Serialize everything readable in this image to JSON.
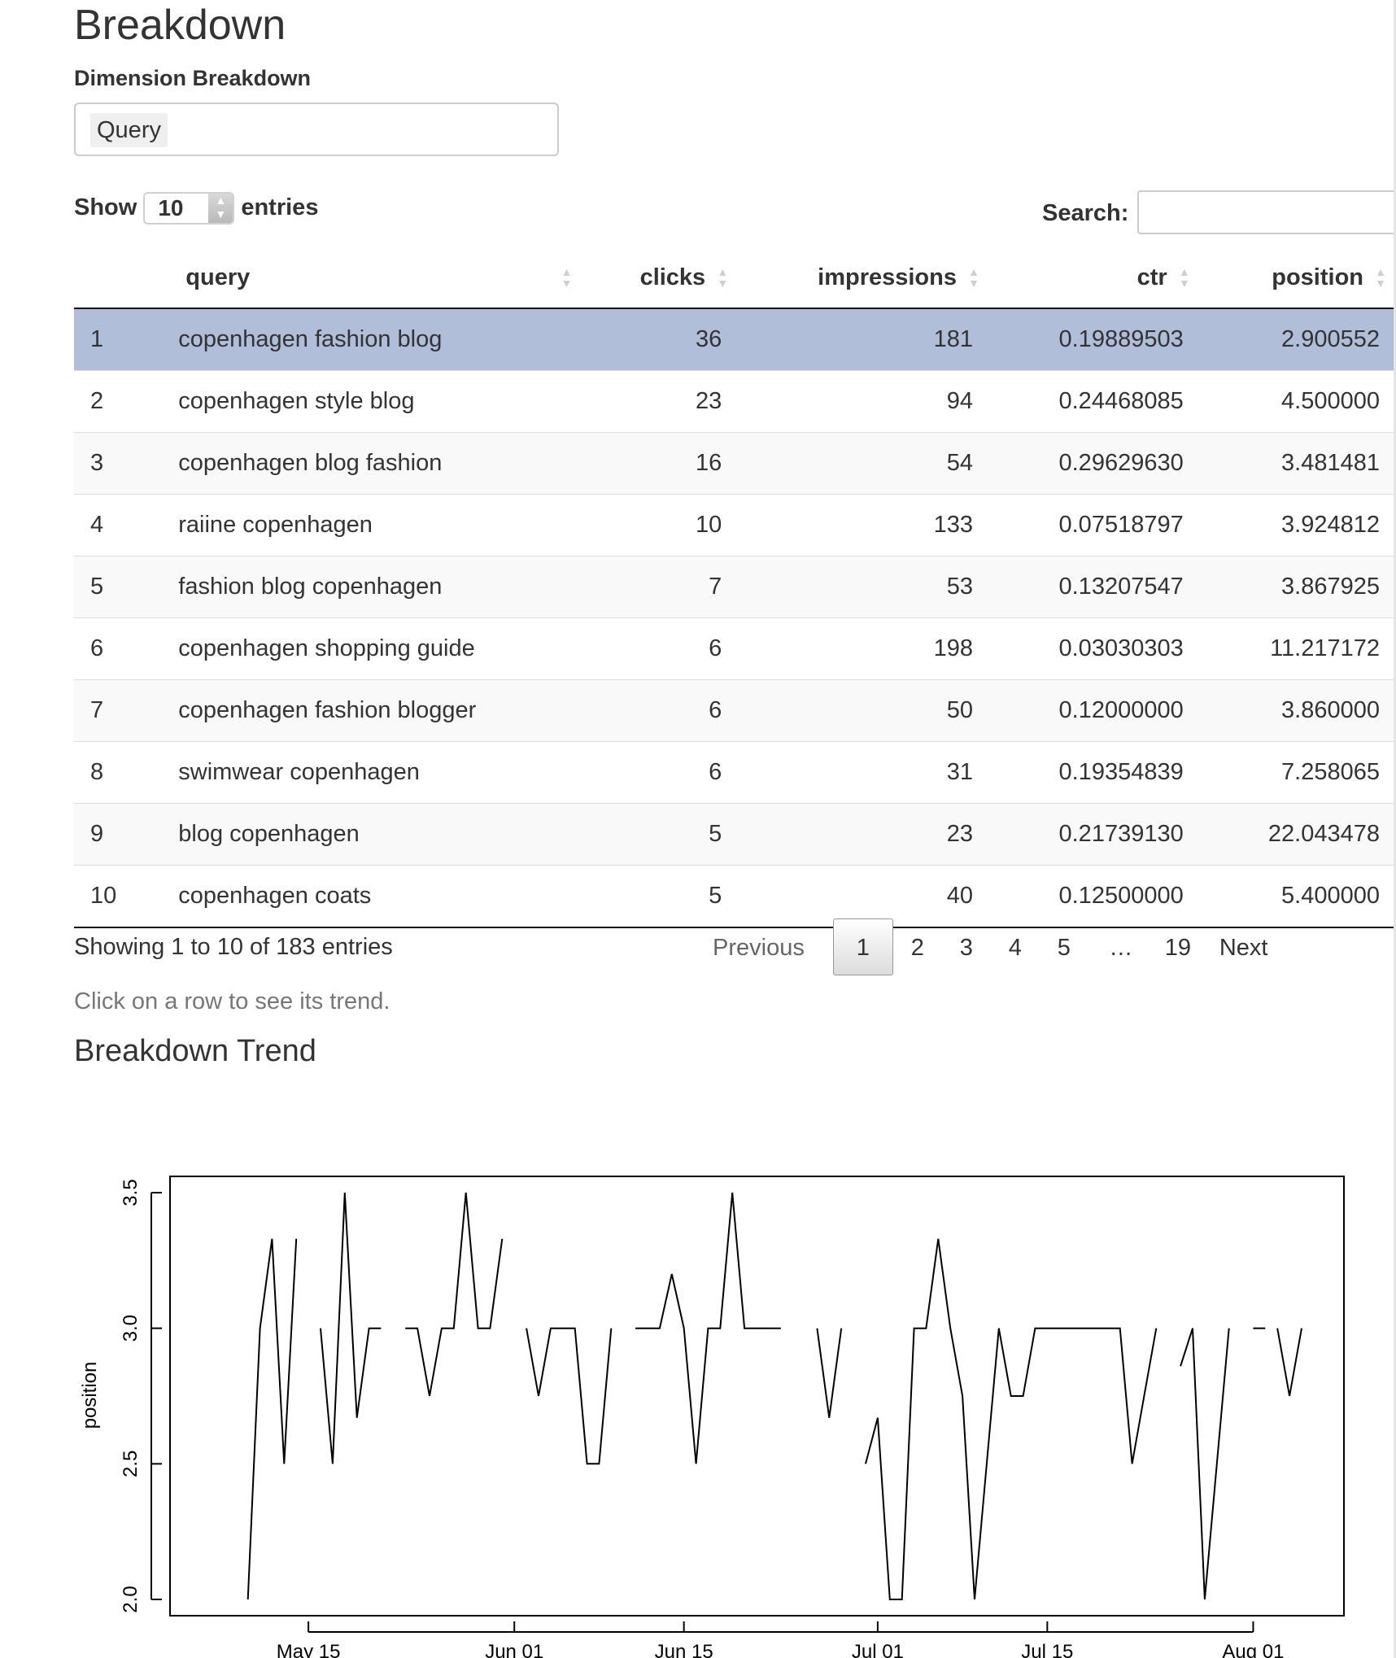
{
  "page_title": "Breakdown",
  "dimension": {
    "label": "Dimension Breakdown",
    "selected": "Query"
  },
  "length_menu": {
    "show_label": "Show",
    "value": "10",
    "entries_label": "entries"
  },
  "search": {
    "label": "Search:",
    "value": ""
  },
  "table": {
    "columns": [
      "",
      "query",
      "clicks",
      "impressions",
      "ctr",
      "position"
    ],
    "rows": [
      [
        "1",
        "copenhagen fashion blog",
        "36",
        "181",
        "0.19889503",
        "2.900552"
      ],
      [
        "2",
        "copenhagen style blog",
        "23",
        "94",
        "0.24468085",
        "4.500000"
      ],
      [
        "3",
        "copenhagen blog fashion",
        "16",
        "54",
        "0.29629630",
        "3.481481"
      ],
      [
        "4",
        "raiine copenhagen",
        "10",
        "133",
        "0.07518797",
        "3.924812"
      ],
      [
        "5",
        "fashion blog copenhagen",
        "7",
        "53",
        "0.13207547",
        "3.867925"
      ],
      [
        "6",
        "copenhagen shopping guide",
        "6",
        "198",
        "0.03030303",
        "11.217172"
      ],
      [
        "7",
        "copenhagen fashion blogger",
        "6",
        "50",
        "0.12000000",
        "3.860000"
      ],
      [
        "8",
        "swimwear copenhagen",
        "6",
        "31",
        "0.19354839",
        "7.258065"
      ],
      [
        "9",
        "blog copenhagen",
        "5",
        "23",
        "0.21739130",
        "22.043478"
      ],
      [
        "10",
        "copenhagen coats",
        "5",
        "40",
        "0.12500000",
        "5.400000"
      ]
    ],
    "selected_row": 1
  },
  "info_text": "Showing 1 to 10 of 183 entries",
  "pagination": {
    "previous": "Previous",
    "pages": [
      "1",
      "2",
      "3",
      "4",
      "5",
      "…",
      "19"
    ],
    "current": "1",
    "next": "Next"
  },
  "help_text": "Click on a row to see its trend.",
  "trend_title": "Breakdown Trend",
  "chart_data": {
    "type": "line",
    "ylabel": "position",
    "xlabel": "",
    "ylim": [
      2.0,
      3.5
    ],
    "y_ticks": [
      "2.0",
      "2.5",
      "3.0",
      "3.5"
    ],
    "x_ticks": [
      {
        "label": "May 15",
        "date": "05-15"
      },
      {
        "label": "Jun 01",
        "date": "06-01"
      },
      {
        "label": "Jun 15",
        "date": "06-15"
      },
      {
        "label": "Jul 01",
        "date": "07-01"
      },
      {
        "label": "Jul 15",
        "date": "07-15"
      },
      {
        "label": "Aug 01",
        "date": "08-01"
      }
    ],
    "xlim": [
      "05-07",
      "08-05"
    ],
    "color": "#000000",
    "series": [
      {
        "points": [
          [
            "05-10",
            2.0
          ],
          [
            "05-11",
            3.0
          ],
          [
            "05-12",
            3.33
          ],
          [
            "05-13",
            2.5
          ],
          [
            "05-14",
            3.33
          ]
        ]
      },
      {
        "points": [
          [
            "05-16",
            3.0
          ],
          [
            "05-17",
            2.5
          ],
          [
            "05-18",
            3.5
          ],
          [
            "05-19",
            2.67
          ],
          [
            "05-20",
            3.0
          ],
          [
            "05-21",
            3.0
          ]
        ]
      },
      {
        "points": [
          [
            "05-23",
            3.0
          ],
          [
            "05-24",
            3.0
          ],
          [
            "05-25",
            2.75
          ],
          [
            "05-26",
            3.0
          ],
          [
            "05-27",
            3.0
          ],
          [
            "05-28",
            3.5
          ],
          [
            "05-29",
            3.0
          ],
          [
            "05-30",
            3.0
          ],
          [
            "05-31",
            3.33
          ]
        ]
      },
      {
        "points": [
          [
            "06-02",
            3.0
          ],
          [
            "06-03",
            2.75
          ],
          [
            "06-04",
            3.0
          ],
          [
            "06-05",
            3.0
          ],
          [
            "06-06",
            3.0
          ],
          [
            "06-07",
            2.5
          ],
          [
            "06-08",
            2.5
          ],
          [
            "06-09",
            3.0
          ]
        ]
      },
      {
        "points": [
          [
            "06-11",
            3.0
          ],
          [
            "06-12",
            3.0
          ],
          [
            "06-13",
            3.0
          ],
          [
            "06-14",
            3.2
          ],
          [
            "06-15",
            3.0
          ],
          [
            "06-16",
            2.5
          ],
          [
            "06-17",
            3.0
          ],
          [
            "06-18",
            3.0
          ],
          [
            "06-19",
            3.5
          ],
          [
            "06-20",
            3.0
          ],
          [
            "06-21",
            3.0
          ],
          [
            "06-22",
            3.0
          ],
          [
            "06-23",
            3.0
          ]
        ]
      },
      {
        "points": [
          [
            "06-26",
            3.0
          ],
          [
            "06-27",
            2.67
          ],
          [
            "06-28",
            3.0
          ]
        ]
      },
      {
        "points": [
          [
            "06-30",
            2.5
          ],
          [
            "07-01",
            2.67
          ],
          [
            "07-02",
            2.0
          ],
          [
            "07-03",
            2.0
          ],
          [
            "07-04",
            3.0
          ],
          [
            "07-05",
            3.0
          ],
          [
            "07-06",
            3.33
          ],
          [
            "07-07",
            3.0
          ],
          [
            "07-08",
            2.75
          ],
          [
            "07-09",
            2.0
          ],
          [
            "07-10",
            2.5
          ],
          [
            "07-11",
            3.0
          ],
          [
            "07-12",
            2.75
          ],
          [
            "07-13",
            2.75
          ],
          [
            "07-14",
            3.0
          ],
          [
            "07-15",
            3.0
          ],
          [
            "07-16",
            3.0
          ],
          [
            "07-17",
            3.0
          ],
          [
            "07-18",
            3.0
          ],
          [
            "07-19",
            3.0
          ],
          [
            "07-20",
            3.0
          ],
          [
            "07-21",
            3.0
          ],
          [
            "07-22",
            2.5
          ],
          [
            "07-23",
            2.75
          ],
          [
            "07-24",
            3.0
          ]
        ]
      },
      {
        "points": [
          [
            "07-26",
            2.86
          ],
          [
            "07-27",
            3.0
          ],
          [
            "07-28",
            2.0
          ],
          [
            "07-29",
            2.5
          ],
          [
            "07-30",
            3.0
          ]
        ]
      },
      {
        "points": [
          [
            "08-01",
            3.0
          ],
          [
            "08-02",
            3.0
          ]
        ]
      },
      {
        "points": [
          [
            "08-03",
            3.0
          ],
          [
            "08-04",
            2.75
          ],
          [
            "08-05",
            3.0
          ]
        ]
      }
    ]
  }
}
